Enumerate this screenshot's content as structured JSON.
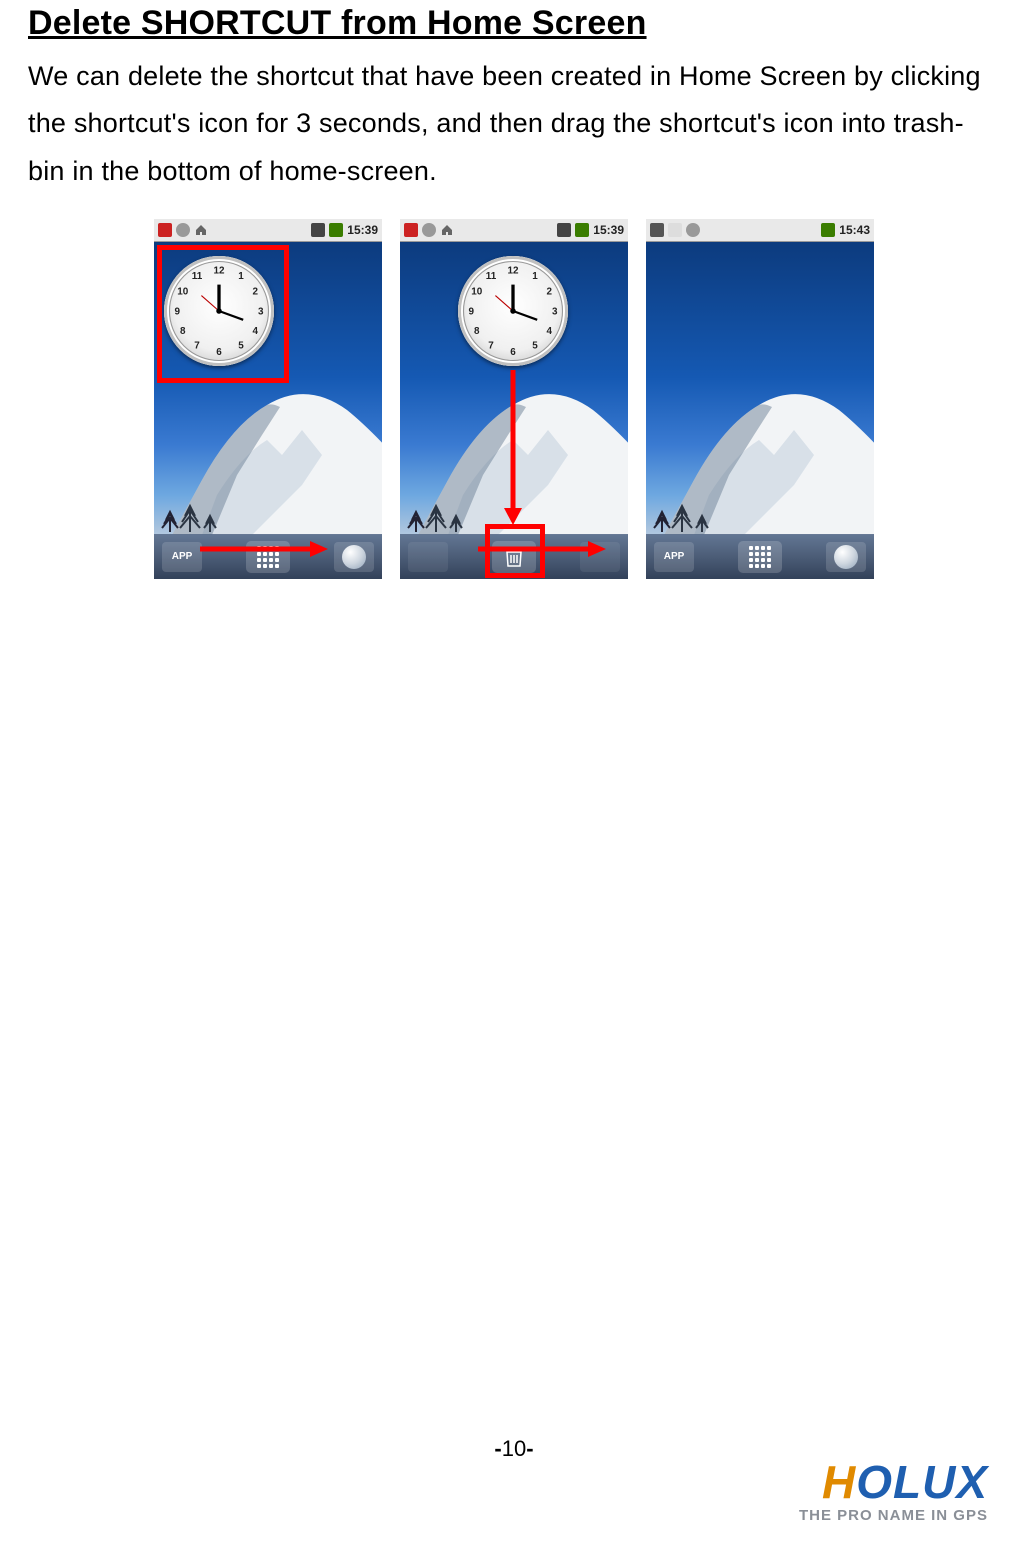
{
  "title": "Delete SHORTCUT from Home Screen",
  "intro": "We can delete the shortcut that have been created in Home Screen by clicking the shortcut's icon for 3 seconds, and then drag the shortcut's icon into trash-bin in the bottom of home-screen.",
  "screenshots": [
    {
      "time": "15:39",
      "has_clock": true,
      "clock_highlight": true,
      "trash_highlight": false,
      "dock_center": "apps"
    },
    {
      "time": "15:39",
      "has_clock": true,
      "clock_highlight": false,
      "trash_highlight": true,
      "dock_center": "trash"
    },
    {
      "time": "15:43",
      "has_clock": false,
      "clock_highlight": false,
      "trash_highlight": false,
      "dock_center": "apps"
    }
  ],
  "dock": {
    "app_label": "APP"
  },
  "clock_numbers": [
    "12",
    "1",
    "2",
    "3",
    "4",
    "5",
    "6",
    "7",
    "8",
    "9",
    "10",
    "11"
  ],
  "page_number": "10",
  "brand": {
    "name": "HOLUX",
    "tagline": "THE PRO NAME IN GPS"
  }
}
